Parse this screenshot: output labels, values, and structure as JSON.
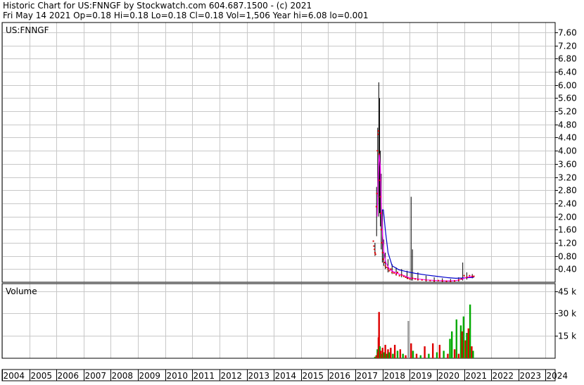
{
  "header": {
    "line1": "Historic Chart for US:FNNGF by Stockwatch.com 604.687.1500 - (c) 2021",
    "line2": "Fri May 14 2021  Op=0.18  Hi=0.18  Lo=0.18  Cl=0.18  Vol=1,506  Year hi=6.08  lo=0.001"
  },
  "price_panel": {
    "symbol_label": "US:FNNGF"
  },
  "volume_panel": {
    "label": "Volume"
  },
  "colors": {
    "grid": "#c8c8c8",
    "up": "#00aa00",
    "down": "#dd0000",
    "neutral": "#999999",
    "ma_short": "#ff00ff",
    "ma_long": "#0000cc",
    "price": "#000000",
    "close_dot": "#dd0000"
  },
  "chart_data": [
    {
      "type": "line",
      "name": "price",
      "ylim": [
        0,
        7.9
      ],
      "yticks": [
        0.4,
        0.8,
        1.2,
        1.6,
        2.0,
        2.4,
        2.8,
        3.2,
        3.6,
        4.0,
        4.4,
        4.8,
        5.2,
        5.6,
        6.0,
        6.4,
        6.8,
        7.2,
        7.6
      ],
      "ytick_labels": [
        "0.40",
        "0.80",
        "1.20",
        "1.60",
        "2.00",
        "2.40",
        "2.80",
        "3.20",
        "3.60",
        "4.00",
        "4.40",
        "4.80",
        "5.20",
        "5.60",
        "6.00",
        "6.40",
        "6.80",
        "7.20",
        "7.60"
      ],
      "x_years": [
        "2004",
        "2005",
        "2006",
        "2007",
        "2008",
        "2009",
        "2010",
        "2011",
        "2012",
        "2013",
        "2014",
        "2015",
        "2016",
        "2017",
        "2018",
        "2019",
        "2020",
        "2021",
        "2022",
        "2023",
        "2024"
      ],
      "xlim": [
        2004.0,
        2024.35
      ],
      "price_bars": [
        [
          2017.72,
          1.2,
          0.8
        ],
        [
          2017.78,
          2.9,
          1.4
        ],
        [
          2017.82,
          4.7,
          2.6
        ],
        [
          2017.86,
          6.08,
          2.0
        ],
        [
          2017.89,
          5.6,
          2.1
        ],
        [
          2017.92,
          4.0,
          1.7
        ],
        [
          2017.95,
          3.3,
          1.0
        ],
        [
          2017.99,
          2.2,
          0.6
        ],
        [
          2018.04,
          1.3,
          0.5
        ],
        [
          2018.1,
          0.9,
          0.4
        ],
        [
          2018.2,
          0.7,
          0.3
        ],
        [
          2018.35,
          0.55,
          0.25
        ],
        [
          2018.5,
          0.45,
          0.2
        ],
        [
          2018.7,
          0.4,
          0.15
        ],
        [
          2018.9,
          0.35,
          0.1
        ],
        [
          2019.05,
          2.6,
          0.05
        ],
        [
          2019.1,
          1.0,
          0.05
        ],
        [
          2019.3,
          0.3,
          0.05
        ],
        [
          2019.6,
          0.2,
          0.02
        ],
        [
          2019.9,
          0.15,
          0.01
        ],
        [
          2020.2,
          0.12,
          0.01
        ],
        [
          2020.5,
          0.1,
          0.001
        ],
        [
          2020.8,
          0.15,
          0.02
        ],
        [
          2020.95,
          0.6,
          0.05
        ],
        [
          2021.1,
          0.3,
          0.08
        ],
        [
          2021.3,
          0.25,
          0.12
        ]
      ],
      "closes": [
        [
          2017.66,
          1.25
        ],
        [
          2017.68,
          1.1
        ],
        [
          2017.7,
          1.0
        ],
        [
          2017.72,
          0.9
        ],
        [
          2017.74,
          0.85
        ],
        [
          2017.77,
          2.3
        ],
        [
          2017.79,
          2.7
        ],
        [
          2017.81,
          4.0
        ],
        [
          2017.83,
          4.5
        ],
        [
          2017.85,
          4.6
        ],
        [
          2017.87,
          3.9
        ],
        [
          2017.89,
          3.1
        ],
        [
          2017.91,
          2.6
        ],
        [
          2017.93,
          2.1
        ],
        [
          2017.95,
          1.6
        ],
        [
          2017.97,
          1.2
        ],
        [
          2018.0,
          0.9
        ],
        [
          2018.03,
          0.7
        ],
        [
          2018.06,
          0.6
        ],
        [
          2018.1,
          0.5
        ],
        [
          2018.15,
          0.45
        ],
        [
          2018.2,
          0.4
        ],
        [
          2018.25,
          0.35
        ],
        [
          2018.3,
          0.4
        ],
        [
          2018.35,
          0.3
        ],
        [
          2018.42,
          0.28
        ],
        [
          2018.5,
          0.25
        ],
        [
          2018.55,
          0.3
        ],
        [
          2018.62,
          0.2
        ],
        [
          2018.7,
          0.22
        ],
        [
          2018.78,
          0.18
        ],
        [
          2018.85,
          0.15
        ],
        [
          2018.93,
          0.12
        ],
        [
          2019.0,
          0.1
        ],
        [
          2019.1,
          0.12
        ],
        [
          2019.2,
          0.1
        ],
        [
          2019.3,
          0.08
        ],
        [
          2019.45,
          0.07
        ],
        [
          2019.6,
          0.06
        ],
        [
          2019.75,
          0.05
        ],
        [
          2019.9,
          0.04
        ],
        [
          2020.05,
          0.05
        ],
        [
          2020.2,
          0.04
        ],
        [
          2020.35,
          0.03
        ],
        [
          2020.5,
          0.03
        ],
        [
          2020.65,
          0.04
        ],
        [
          2020.8,
          0.06
        ],
        [
          2020.9,
          0.1
        ],
        [
          2021.0,
          0.2
        ],
        [
          2021.1,
          0.15
        ],
        [
          2021.2,
          0.2
        ],
        [
          2021.3,
          0.18
        ],
        [
          2021.36,
          0.18
        ]
      ],
      "ma_short": [
        [
          2017.8,
          2.0
        ],
        [
          2017.84,
          3.3
        ],
        [
          2017.88,
          3.9
        ],
        [
          2017.92,
          3.5
        ],
        [
          2017.96,
          2.2
        ],
        [
          2018.0,
          1.4
        ],
        [
          2018.05,
          0.9
        ],
        [
          2018.12,
          0.6
        ],
        [
          2018.25,
          0.4
        ],
        [
          2018.4,
          0.32
        ],
        [
          2018.6,
          0.25
        ],
        [
          2018.8,
          0.2
        ],
        [
          2019.0,
          0.13
        ],
        [
          2019.3,
          0.1
        ],
        [
          2019.6,
          0.07
        ],
        [
          2020.0,
          0.05
        ],
        [
          2020.4,
          0.04
        ],
        [
          2020.7,
          0.05
        ],
        [
          2020.9,
          0.09
        ],
        [
          2021.1,
          0.15
        ],
        [
          2021.36,
          0.18
        ]
      ],
      "ma_long": [
        [
          2017.98,
          2.2
        ],
        [
          2018.03,
          2.2
        ],
        [
          2018.1,
          1.6
        ],
        [
          2018.2,
          0.9
        ],
        [
          2018.35,
          0.5
        ],
        [
          2018.6,
          0.38
        ],
        [
          2018.9,
          0.32
        ],
        [
          2019.2,
          0.27
        ],
        [
          2019.6,
          0.22
        ],
        [
          2020.0,
          0.18
        ],
        [
          2020.4,
          0.14
        ],
        [
          2020.7,
          0.12
        ],
        [
          2021.0,
          0.13
        ],
        [
          2021.36,
          0.15
        ]
      ]
    },
    {
      "type": "bar",
      "name": "volume",
      "ylim": [
        0,
        50
      ],
      "yticks": [
        15,
        30,
        45
      ],
      "ytick_labels": [
        "15 k",
        "30 k",
        "45 k"
      ],
      "bars": [
        [
          2017.72,
          1,
          "up"
        ],
        [
          2017.77,
          2,
          "down"
        ],
        [
          2017.81,
          6,
          "up"
        ],
        [
          2017.83,
          4,
          "down"
        ],
        [
          2017.85,
          14,
          "down"
        ],
        [
          2017.87,
          31,
          "down"
        ],
        [
          2017.9,
          8,
          "up"
        ],
        [
          2017.93,
          5,
          "down"
        ],
        [
          2017.97,
          3,
          "up"
        ],
        [
          2018.0,
          7,
          "down"
        ],
        [
          2018.05,
          4,
          "up"
        ],
        [
          2018.1,
          9,
          "down"
        ],
        [
          2018.15,
          3,
          "up"
        ],
        [
          2018.2,
          6,
          "down"
        ],
        [
          2018.25,
          4,
          "up"
        ],
        [
          2018.3,
          7,
          "down"
        ],
        [
          2018.38,
          3,
          "up"
        ],
        [
          2018.45,
          9,
          "down"
        ],
        [
          2018.55,
          5,
          "up"
        ],
        [
          2018.65,
          6,
          "down"
        ],
        [
          2018.75,
          3,
          "up"
        ],
        [
          2018.85,
          2,
          "down"
        ],
        [
          2018.95,
          25,
          "neutral"
        ],
        [
          2019.05,
          10,
          "down"
        ],
        [
          2019.12,
          5,
          "up"
        ],
        [
          2019.25,
          3,
          "down"
        ],
        [
          2019.4,
          2,
          "up"
        ],
        [
          2019.55,
          8,
          "down"
        ],
        [
          2019.7,
          3,
          "up"
        ],
        [
          2019.85,
          10,
          "down"
        ],
        [
          2020.0,
          4,
          "up"
        ],
        [
          2020.1,
          9,
          "down"
        ],
        [
          2020.25,
          5,
          "up"
        ],
        [
          2020.4,
          3,
          "down"
        ],
        [
          2020.48,
          13,
          "up"
        ],
        [
          2020.55,
          18,
          "up"
        ],
        [
          2020.65,
          6,
          "down"
        ],
        [
          2020.72,
          26,
          "up"
        ],
        [
          2020.8,
          3,
          "down"
        ],
        [
          2020.88,
          22,
          "up"
        ],
        [
          2020.93,
          18,
          "down"
        ],
        [
          2020.98,
          28,
          "up"
        ],
        [
          2021.05,
          12,
          "down"
        ],
        [
          2021.1,
          17,
          "up"
        ],
        [
          2021.16,
          20,
          "down"
        ],
        [
          2021.22,
          36,
          "up"
        ],
        [
          2021.28,
          8,
          "down"
        ],
        [
          2021.33,
          5,
          "up"
        ]
      ]
    }
  ]
}
